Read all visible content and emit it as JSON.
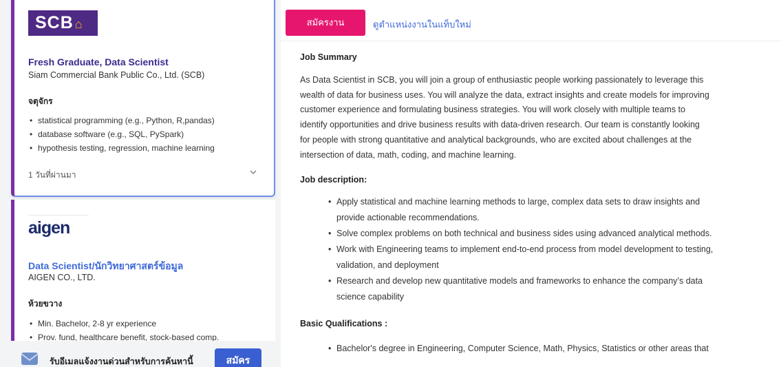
{
  "cards": [
    {
      "logo": "SCB",
      "logo_mark": "⌂",
      "title": "Fresh Graduate, Data Scientist",
      "company": "Siam Commercial Bank Public Co., Ltd. (SCB)",
      "location": "จตุจักร",
      "bullets": [
        "statistical programming (e.g., Python, R,pandas)",
        "database software (e.g., SQL, PySpark)",
        "hypothesis testing, regression, machine learning"
      ],
      "posted": "1 วันที่ผ่านมา"
    },
    {
      "logo": "aigen",
      "title": "Data Scientist/นักวิทยาศาสตร์ข้อมูล",
      "company": "AIGEN CO., LTD.",
      "location": "ห้วยขวาง",
      "bullets": [
        "Min. Bachelor, 2-8 yr experience",
        "Prov. fund, healthcare benefit, stock-based comp."
      ]
    }
  ],
  "alert": {
    "text": "รับอีเมลแจ้งงานด่วนสำหรับการค้นหานี้",
    "button": "สมัคร"
  },
  "detail": {
    "apply_label": "สมัครงาน",
    "newtab_label": "ดูตำแหน่งงานในแท็บใหม่",
    "summary_heading": "Job Summary",
    "summary_lines": [
      "As Data Scientist in SCB, you will join a group of enthusiastic people working passionately to leverage this",
      "wealth of data for business uses. You will analyze the data, extract insights and create models for improving",
      "customer experience and formulating business strategies. You will work closely with multiple teams to",
      "identify opportunities and drive business results with data-driven research. Our team is constantly looking",
      "for people with strong quantitative and analytical backgrounds, who are excited about challenges at the",
      "intersection of data, math, coding, and machine learning."
    ],
    "desc_heading": "Job description:",
    "desc_items": [
      [
        "Apply statistical and machine learning methods to large, complex data sets to draw insights and",
        "provide actionable recommendations."
      ],
      [
        "Solve complex problems on both technical and business sides using advanced analytical methods."
      ],
      [
        "Work with Engineering teams to implement end-to-end process from model development to testing,",
        "validation, and deployment"
      ],
      [
        "Research and develop new quantitative models and frameworks to enhance the company’s data",
        "science capability"
      ]
    ],
    "qual_heading": "Basic Qualifications :",
    "qual_first": "Bachelor's degree in Engineering, Computer Science, Math, Physics, Statistics or other areas that"
  },
  "colors": {
    "accent_pink": "#e6166e",
    "brand_purple": "#4e2a84",
    "link_blue": "#3f6ad8",
    "page_bg": "#0b2f4f"
  }
}
